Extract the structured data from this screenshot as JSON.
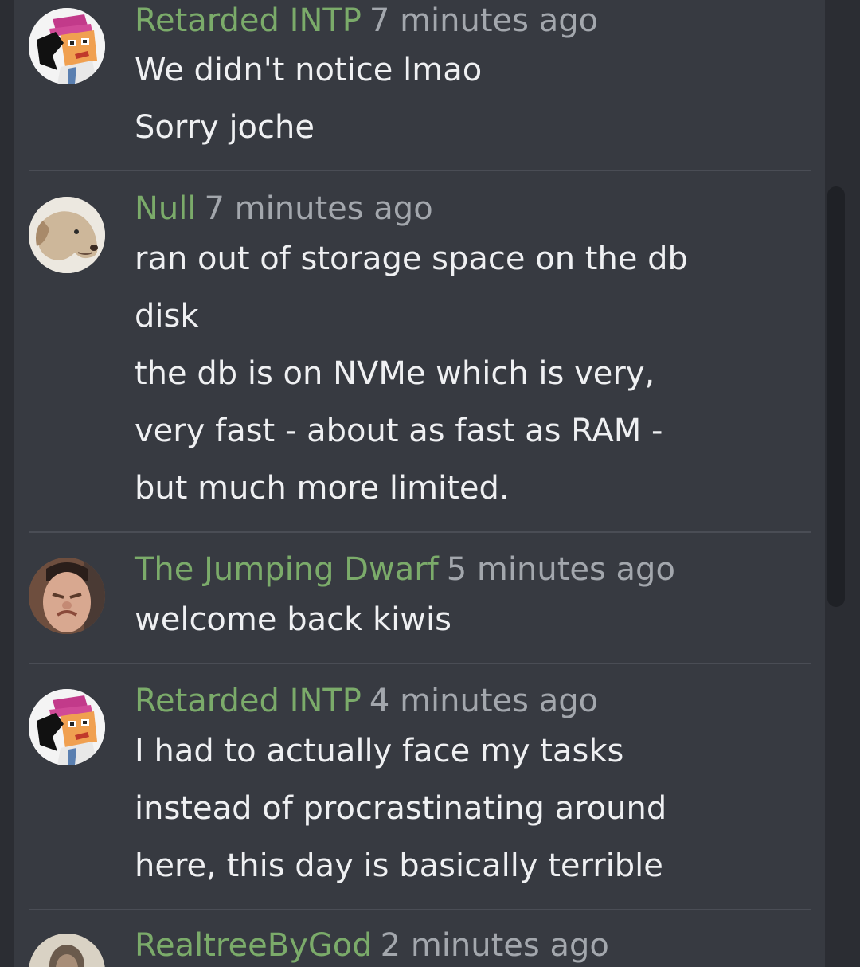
{
  "messages": [
    {
      "username": "Retarded INTP",
      "time": "7 minutes ago",
      "avatar_icon": "pixel-art-character-icon",
      "lines": [
        "We didn't notice lmao",
        "Sorry joche"
      ]
    },
    {
      "username": "Null",
      "time": "7 minutes ago",
      "avatar_icon": "dog-icon",
      "lines": [
        "ran out of storage space on the db",
        "disk",
        "the db is on NVMe which is very,",
        "very fast - about as fast as RAM -",
        "but much more limited."
      ]
    },
    {
      "username": "The Jumping Dwarf",
      "time": "5 minutes ago",
      "avatar_icon": "face-photo-icon",
      "lines": [
        "welcome back kiwis"
      ]
    },
    {
      "username": "Retarded INTP",
      "time": "4 minutes ago",
      "avatar_icon": "pixel-art-character-icon",
      "lines": [
        "I had to actually face my tasks",
        "instead of procrastinating around",
        "here, this day is basically terrible"
      ]
    },
    {
      "username": "RealtreeByGod",
      "time": "2 minutes ago",
      "avatar_icon": "portrait-photo-icon",
      "lines": []
    }
  ],
  "colors": {
    "background": "#2b2d33",
    "panel": "#373a41",
    "username": "#7bab6a",
    "timestamp": "#a3a7ad",
    "text": "#eff0f2",
    "divider": "#4a4d55"
  }
}
